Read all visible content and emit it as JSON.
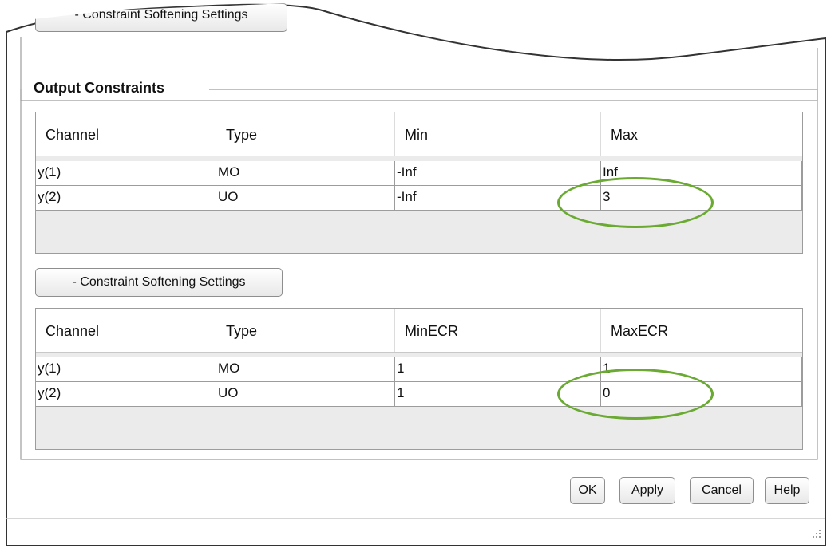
{
  "top_section": {
    "softening_button_label": "- Constraint Softening Settings"
  },
  "output_constraints": {
    "title": "Output Constraints",
    "columns": [
      "Channel",
      "Type",
      "Min",
      "Max"
    ],
    "rows": [
      [
        "y(1)",
        "MO",
        "-Inf",
        "Inf"
      ],
      [
        "y(2)",
        "UO",
        "-Inf",
        "3"
      ]
    ]
  },
  "softening": {
    "button_label": "- Constraint Softening Settings",
    "columns": [
      "Channel",
      "Type",
      "MinECR",
      "MaxECR"
    ],
    "rows": [
      [
        "y(1)",
        "MO",
        "1",
        "1"
      ],
      [
        "y(2)",
        "UO",
        "1",
        "0"
      ]
    ]
  },
  "footer": {
    "ok": "OK",
    "apply": "Apply",
    "cancel": "Cancel",
    "help": "Help"
  },
  "colors": {
    "highlight": "#6aaa32",
    "panel_border": "#9c9c9c"
  }
}
